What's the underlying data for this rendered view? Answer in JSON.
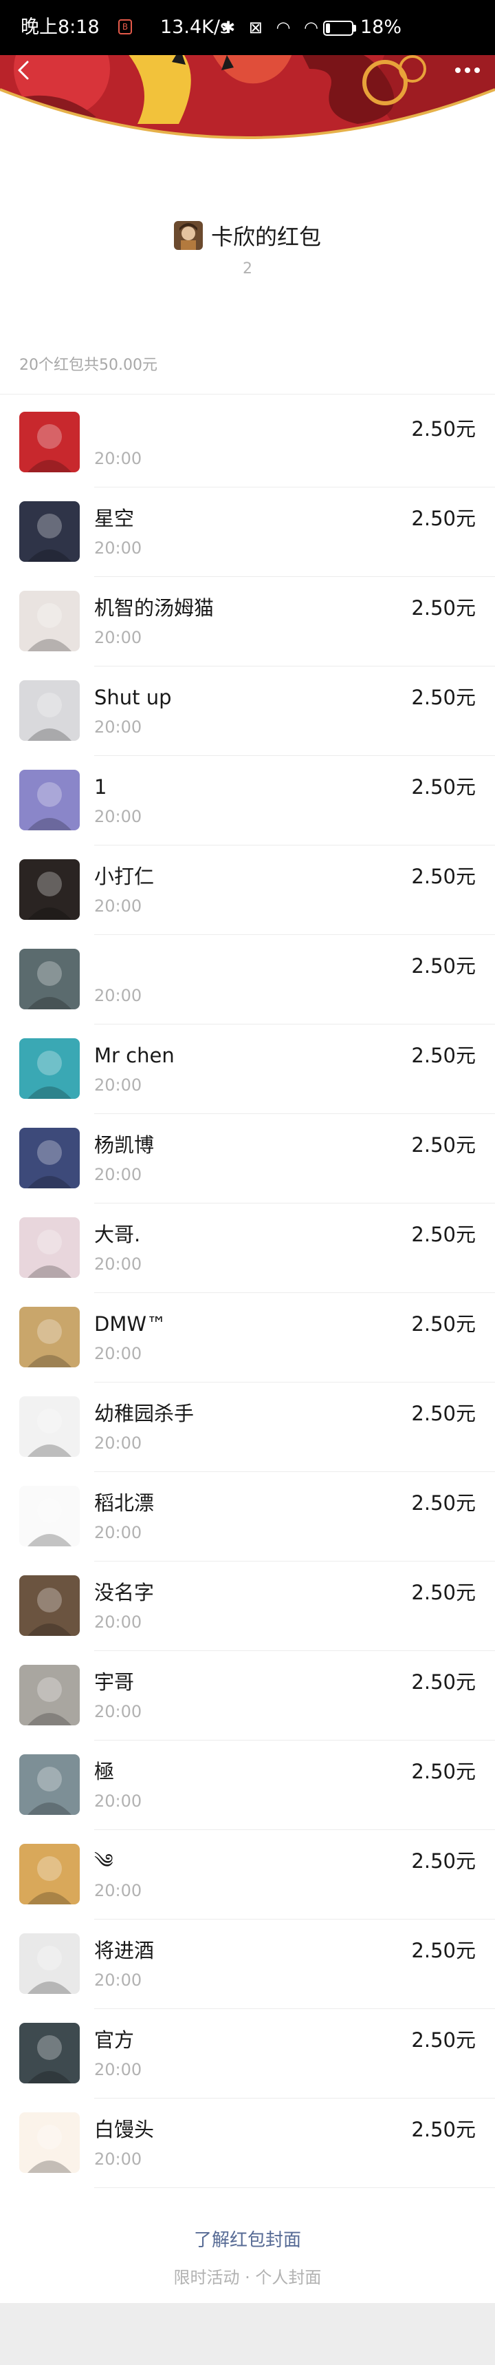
{
  "status_bar": {
    "time": "晚上8:18",
    "app_badge": "B",
    "net_speed": "13.4K/s",
    "icons": "✱ ⊠ ◠ ◠",
    "battery_percent": 18,
    "battery_label": "18%"
  },
  "nav": {
    "back_icon": "back-arrow-icon",
    "more_icon": "more-dots-icon"
  },
  "sender": {
    "title": "卡欣的红包",
    "count": "2"
  },
  "summary": "20个红包共50.00元",
  "recipients": [
    {
      "name": "",
      "time": "20:00",
      "amount": "2.50元",
      "avatar_color": "#c8282d"
    },
    {
      "name": "星空",
      "time": "20:00",
      "amount": "2.50元",
      "avatar_color": "#2f3448"
    },
    {
      "name": "机智的汤姆猫",
      "time": "20:00",
      "amount": "2.50元",
      "avatar_color": "#e9e3e0"
    },
    {
      "name": "Shut up",
      "time": "20:00",
      "amount": "2.50元",
      "avatar_color": "#d9d9dc"
    },
    {
      "name": "1",
      "time": "20:00",
      "amount": "2.50元",
      "avatar_color": "#8a86c9"
    },
    {
      "name": "小打仁",
      "time": "20:00",
      "amount": "2.50元",
      "avatar_color": "#2a2422"
    },
    {
      "name": "",
      "time": "20:00",
      "amount": "2.50元",
      "avatar_color": "#5b6b6e"
    },
    {
      "name": "Mr chen",
      "time": "20:00",
      "amount": "2.50元",
      "avatar_color": "#3aa8b4"
    },
    {
      "name": "杨凯博",
      "time": "20:00",
      "amount": "2.50元",
      "avatar_color": "#3d4a7a"
    },
    {
      "name": "大哥.",
      "time": "20:00",
      "amount": "2.50元",
      "avatar_color": "#e8d6dc"
    },
    {
      "name": "DMW™",
      "time": "20:00",
      "amount": "2.50元",
      "avatar_color": "#c9a66b"
    },
    {
      "name": "幼稚园杀手",
      "time": "20:00",
      "amount": "2.50元",
      "avatar_color": "#f2f2f2"
    },
    {
      "name": "稻北漂",
      "time": "20:00",
      "amount": "2.50元",
      "avatar_color": "#fafafa"
    },
    {
      "name": "没名字",
      "time": "20:00",
      "amount": "2.50元",
      "avatar_color": "#6b5440"
    },
    {
      "name": "宇哥",
      "time": "20:00",
      "amount": "2.50元",
      "avatar_color": "#a9a6a0"
    },
    {
      "name": "極",
      "time": "20:00",
      "amount": "2.50元",
      "avatar_color": "#7d8f96"
    },
    {
      "name": "༄",
      "time": "20:00",
      "amount": "2.50元",
      "avatar_color": "#d9a85a"
    },
    {
      "name": "将进酒",
      "time": "20:00",
      "amount": "2.50元",
      "avatar_color": "#e9e9e9"
    },
    {
      "name": "官方",
      "time": "20:00",
      "amount": "2.50元",
      "avatar_color": "#3e4a4f"
    },
    {
      "name": "白馒头",
      "time": "20:00",
      "amount": "2.50元",
      "avatar_color": "#fbf3ea"
    }
  ],
  "footer": {
    "cover_link": "了解红包封面",
    "promo": "限时活动 · 个人封面"
  },
  "colors": {
    "banner_red": "#c8282d",
    "banner_edge": "#e6b14a",
    "link_blue": "#576b95"
  }
}
